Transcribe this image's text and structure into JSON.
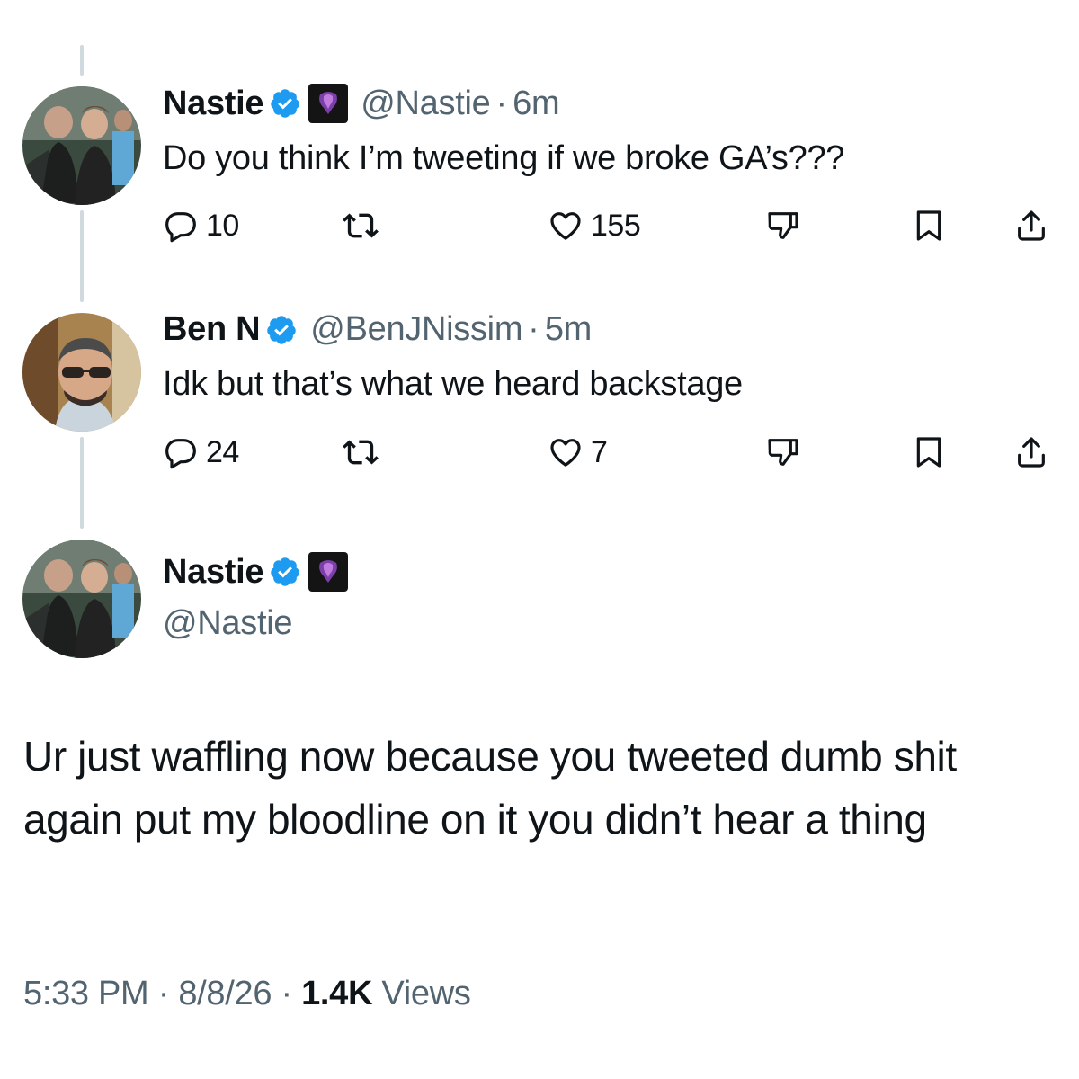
{
  "tweets": [
    {
      "name": "Nastie",
      "handle": "@Nastie",
      "separator": "·",
      "time": "6m",
      "text": "Do you think I’m tweeting if we broke GA’s???",
      "replies": "10",
      "likes": "155"
    },
    {
      "name": "Ben N",
      "handle": "@BenJNissim",
      "separator": "·",
      "time": "5m",
      "text": "Idk but that’s what we heard backstage",
      "replies": "24",
      "likes": "7"
    }
  ],
  "main": {
    "name": "Nastie",
    "handle": "@Nastie",
    "text": "Ur just waffling now because you tweeted dumb shit again put my bloodline on it you didn’t hear a thing",
    "time": "5:33 PM",
    "separator": "·",
    "date": "8/8/26",
    "views_count": "1.4K",
    "views_label": "Views"
  },
  "icons": {
    "reply": "reply-icon",
    "retweet": "retweet-icon",
    "like": "heart-icon",
    "dislike": "thumbs-down-icon",
    "bookmark": "bookmark-icon",
    "share": "share-icon",
    "verified": "verified-badge-icon",
    "affiliate": "affiliate-logo-icon"
  },
  "colors": {
    "text": "#0f1419",
    "secondary": "#536471",
    "verified": "#1d9bf0",
    "thread_line": "#cfd9de"
  }
}
